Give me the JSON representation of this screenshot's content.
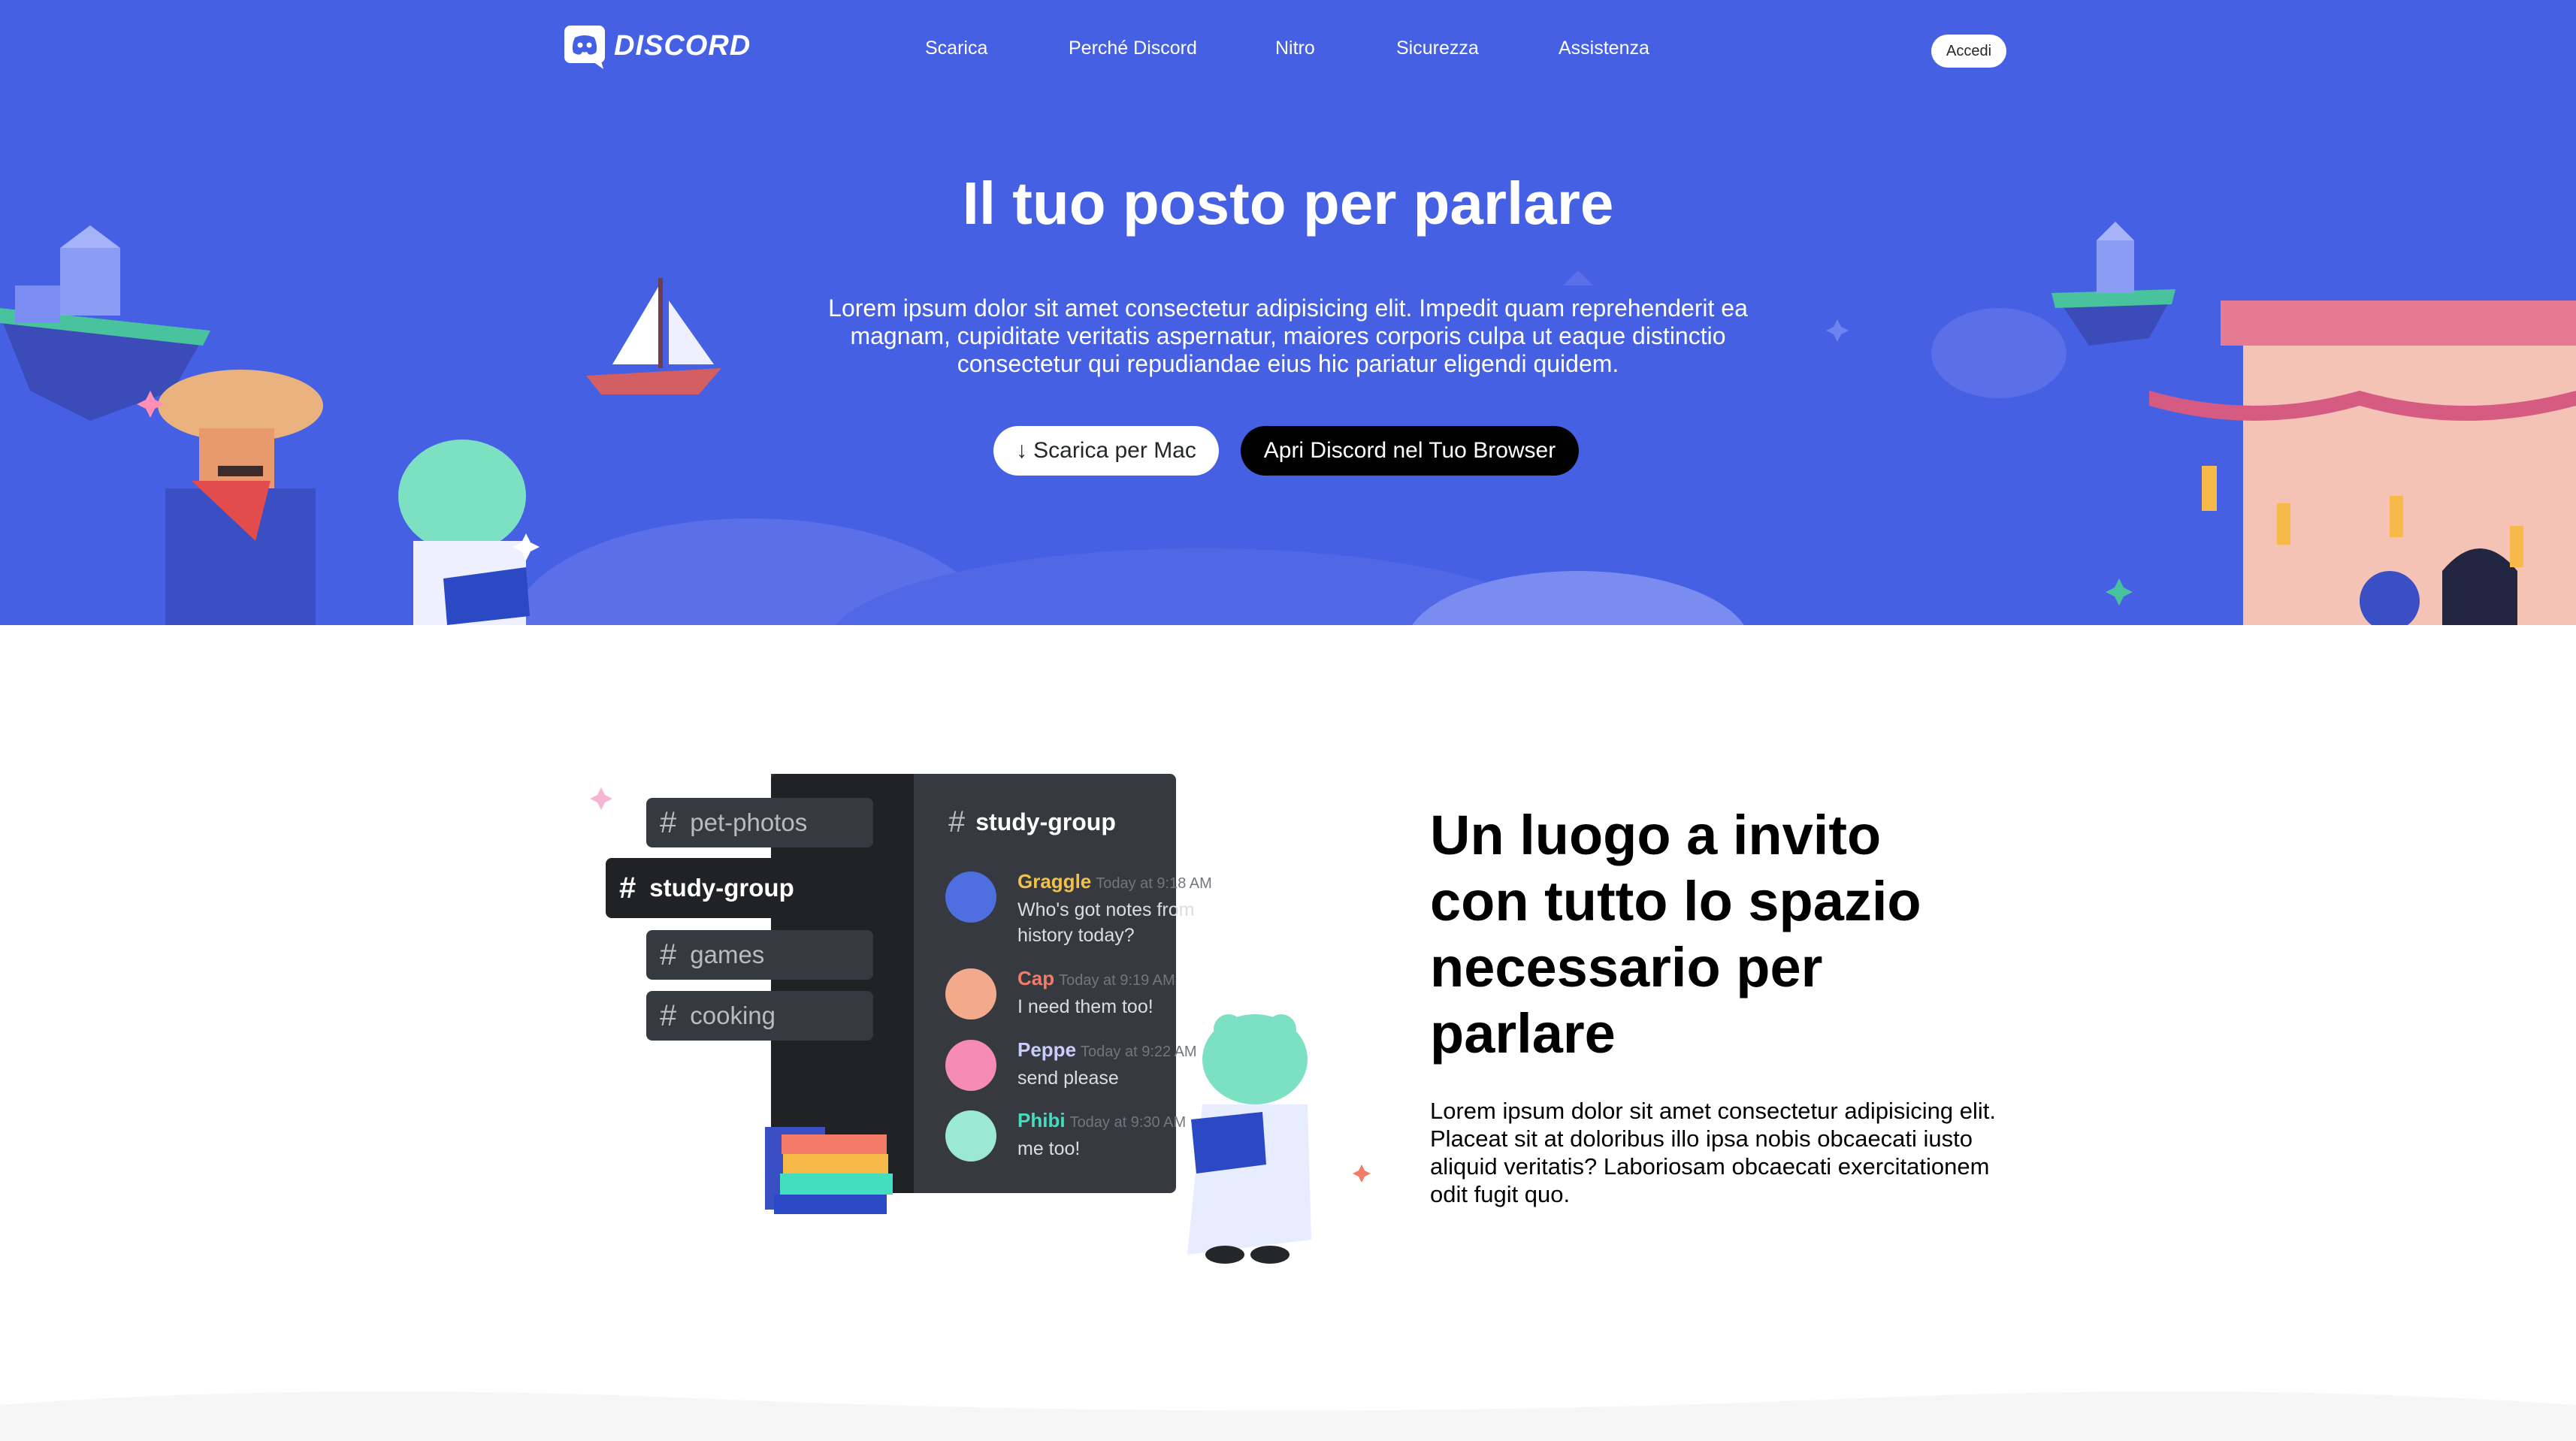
{
  "nav": {
    "logo_text": "DISCORD",
    "links": [
      "Scarica",
      "Perché Discord",
      "Nitro",
      "Sicurezza",
      "Assistenza"
    ],
    "login_label": "Accedi"
  },
  "hero": {
    "title": "Il tuo posto per parlare",
    "text": "Lorem ipsum dolor sit amet consectetur adipisicing elit. Impedit quam reprehenderit ea magnam, cupiditate veritatis aspernatur, maiores corporis culpa ut eaque distinctio consectetur qui repudiandae eius hic pariatur eligendi quidem.",
    "download_icon": "↓",
    "download_label": "Scarica per Mac",
    "browser_label": "Apri Discord nel Tuo Browser"
  },
  "feature": {
    "title": "Un luogo a invito con tutto lo spazio necessario per parlare",
    "text": "Lorem ipsum dolor sit amet consectetur adipisicing elit. Placeat sit at doloribus illo ipsa nobis obcaecati iusto aliquid veritatis? Laboriosam obcaecati exercitationem odit fugit quo."
  },
  "mock": {
    "channels": [
      "pet-photos",
      "study-group",
      "games",
      "cooking"
    ],
    "header": "study-group",
    "hash_icon": "#",
    "messages": [
      {
        "author": "Graggle",
        "time": "Today at 9:18 AM",
        "text": "Who's got notes from history today?",
        "color": "#f0c14b"
      },
      {
        "author": "Cap",
        "time": "Today at 9:19 AM",
        "text": "I need them too!",
        "color": "#f47b67"
      },
      {
        "author": "Peppe",
        "time": "Today at 9:22 AM",
        "text": "send please",
        "color": "#c9cdfb"
      },
      {
        "author": "Phibi",
        "time": "Today at 9:30 AM",
        "text": "me too!",
        "color": "#45ddc0"
      }
    ]
  },
  "colors": {
    "blurple": "#4560e3",
    "dark": "#36393f",
    "darker": "#202225"
  }
}
